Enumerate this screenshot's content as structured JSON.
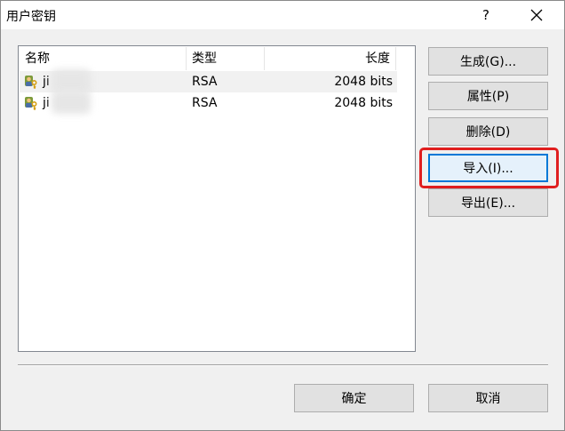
{
  "window": {
    "title": "用户密钥",
    "help_label": "?"
  },
  "list": {
    "columns": [
      "名称",
      "类型",
      "长度"
    ],
    "rows": [
      {
        "name": "ji",
        "type": "RSA",
        "length": "2048 bits",
        "selected": true
      },
      {
        "name": "ji",
        "type": "RSA",
        "length": "2048 bits",
        "selected": false
      }
    ]
  },
  "buttons": {
    "generate": "生成(G)...",
    "properties": "属性(P)",
    "delete": "删除(D)",
    "import": "导入(I)...",
    "export": "导出(E)...",
    "ok": "确定",
    "cancel": "取消"
  },
  "colors": {
    "highlight": "#e01e1e",
    "focus": "#0078d7"
  },
  "icons": {
    "row_icon": "key-user-icon",
    "close": "close-icon"
  }
}
